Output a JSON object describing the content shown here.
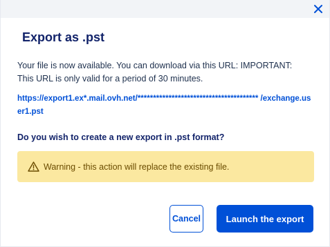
{
  "dialog": {
    "close_icon": "close-icon",
    "title": "Export as .pst",
    "message": "Your file is now available. You can download via this URL: IMPORTANT: This URL is only valid for a period of 30 minutes.",
    "url": "https://export1.ex*.mail.ovh.net/*************************************** /exchange.user1.pst",
    "question": "Do you wish to create a new export in .pst format?",
    "warning": {
      "icon": "warning-icon",
      "text": "Warning - this action will replace the existing file."
    },
    "buttons": {
      "cancel_label": "Cancel",
      "launch_label": "Launch the export"
    }
  },
  "colors": {
    "primary": "#0050d7",
    "title": "#12236a",
    "warning_bg": "#fbe8a0"
  }
}
